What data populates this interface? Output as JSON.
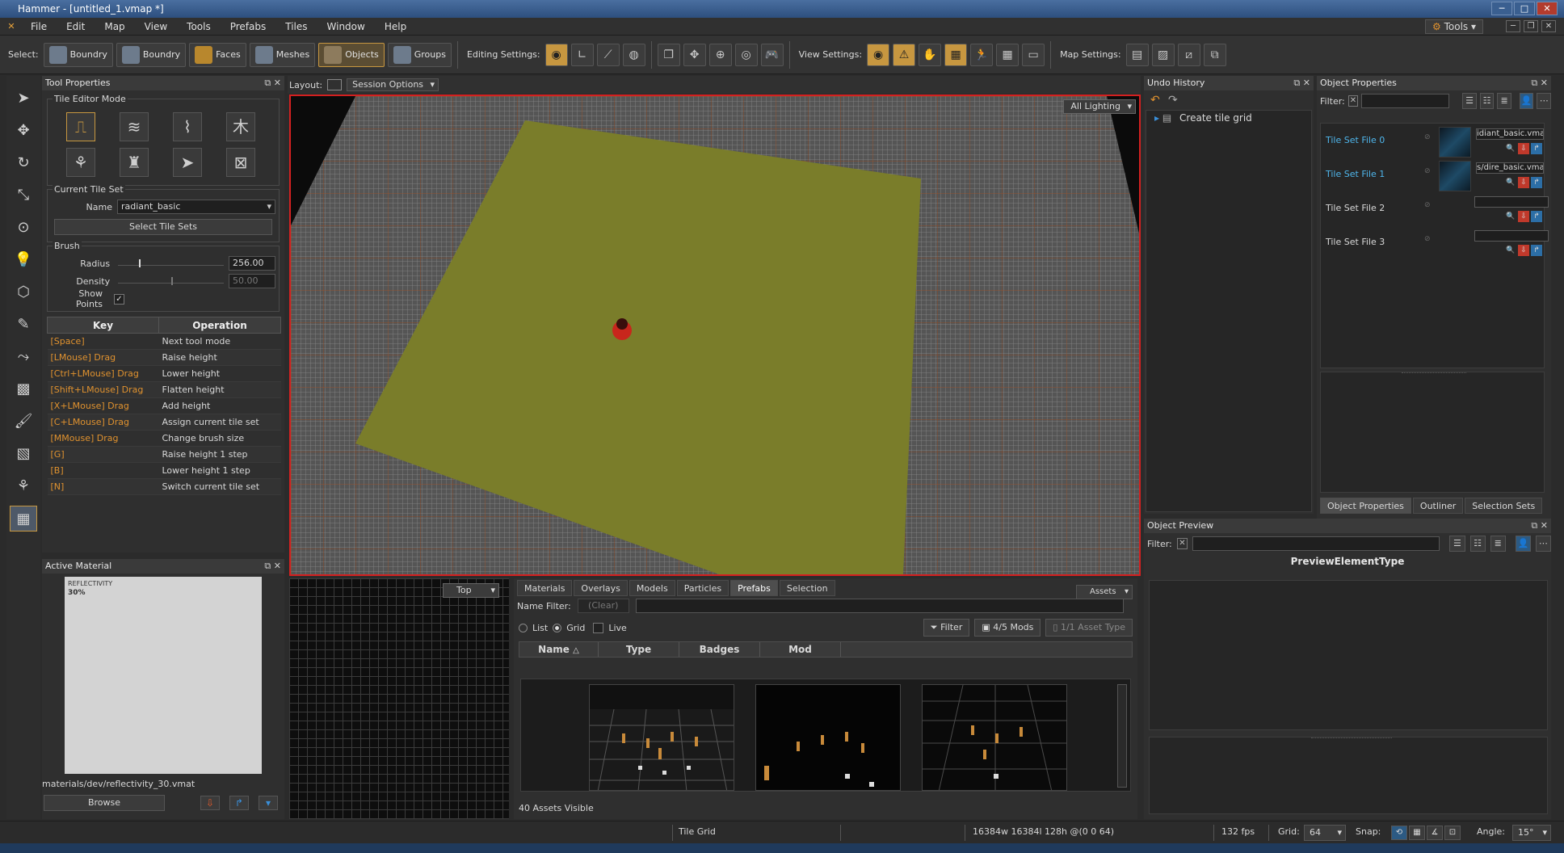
{
  "window": {
    "title": "Hammer - [untitled_1.vmap *]"
  },
  "menu": [
    "File",
    "Edit",
    "Map",
    "View",
    "Tools",
    "Prefabs",
    "Tiles",
    "Window",
    "Help"
  ],
  "tools_dropdown": "Tools",
  "toolbar": {
    "select_label": "Select:",
    "select_buttons": [
      "Boundry",
      "Boundry",
      "Faces",
      "Meshes",
      "Objects",
      "Groups"
    ],
    "editing_label": "Editing Settings:",
    "view_label": "View Settings:",
    "map_label": "Map Settings:"
  },
  "tool_properties": {
    "title": "Tool Properties",
    "tile_editor_mode": "Tile Editor Mode",
    "current_tile_set": "Current Tile Set",
    "name_label": "Name",
    "name_value": "radiant_basic",
    "select_tile_sets": "Select Tile Sets",
    "brush": "Brush",
    "radius_label": "Radius",
    "radius_value": "256.00",
    "radius_level": 0.2,
    "density_label": "Density",
    "density_value": "50.00",
    "density_level": 0.5,
    "show_points": "Show Points",
    "table_headers": [
      "Key",
      "Operation"
    ],
    "keys": [
      {
        "key": "[Space]",
        "op": "Next tool mode"
      },
      {
        "key": "[LMouse] Drag",
        "op": "Raise height"
      },
      {
        "key": "[Ctrl+LMouse] Drag",
        "op": "Lower height"
      },
      {
        "key": "[Shift+LMouse] Drag",
        "op": "Flatten height"
      },
      {
        "key": "[X+LMouse] Drag",
        "op": "Add height"
      },
      {
        "key": "[C+LMouse] Drag",
        "op": "Assign current tile set"
      },
      {
        "key": "[MMouse] Drag",
        "op": "Change brush size"
      },
      {
        "key": "[G]",
        "op": "Raise height 1 step"
      },
      {
        "key": "[B]",
        "op": "Lower height 1 step"
      },
      {
        "key": "[N]",
        "op": "Switch current tile set"
      }
    ]
  },
  "active_material": {
    "title": "Active Material",
    "preview_label": "REFLECTIVITY",
    "preview_value": "30%",
    "path": "materials/dev/reflectivity_30.vmat",
    "browse": "Browse"
  },
  "layout": {
    "label": "Layout:",
    "session_options": "Session Options"
  },
  "viewport": {
    "lighting": "All Lighting",
    "ortho_view": "Top"
  },
  "asset_browser": {
    "tabs": [
      "Materials",
      "Overlays",
      "Models",
      "Particles",
      "Prefabs",
      "Selection"
    ],
    "active_tab": "Prefabs",
    "assets_dropdown": "Assets",
    "name_filter_label": "Name Filter:",
    "clear": "(Clear)",
    "view_list": "List",
    "view_grid": "Grid",
    "live": "Live",
    "filter_btn": "Filter",
    "mods_btn": "4/5 Mods",
    "asset_type_btn": "1/1 Asset Type",
    "columns": [
      "Name",
      "Type",
      "Badges",
      "Mod"
    ],
    "sort_indicator": "△",
    "count": "40 Assets Visible"
  },
  "undo_history": {
    "title": "Undo History",
    "items": [
      "Create tile grid"
    ]
  },
  "object_properties": {
    "title": "Object Properties",
    "filter_label": "Filter:",
    "tile_set_files": [
      {
        "label": "Tile Set File 0",
        "path": "idiant_basic.vmap",
        "active": true
      },
      {
        "label": "Tile Set File 1",
        "path": "s/dire_basic.vmap",
        "active": true
      },
      {
        "label": "Tile Set File 2",
        "path": "",
        "active": false
      },
      {
        "label": "Tile Set File 3",
        "path": "",
        "active": false
      }
    ],
    "bottom_tabs": [
      "Object Properties",
      "Outliner",
      "Selection Sets"
    ]
  },
  "object_preview": {
    "title": "Object Preview",
    "filter_label": "Filter:",
    "element_type": "PreviewElementType"
  },
  "status": {
    "tool": "Tile Grid",
    "dims": "16384w 16384l 128h @(0 0 64)",
    "fps": "132 fps",
    "grid_label": "Grid:",
    "grid_value": "64",
    "snap_label": "Snap:",
    "angle_label": "Angle:",
    "angle_value": "15°"
  },
  "colors": {
    "accent": "#c79740",
    "key_text": "#e0922f",
    "selection_border": "#d42020",
    "link_blue": "#4fb6ec"
  }
}
